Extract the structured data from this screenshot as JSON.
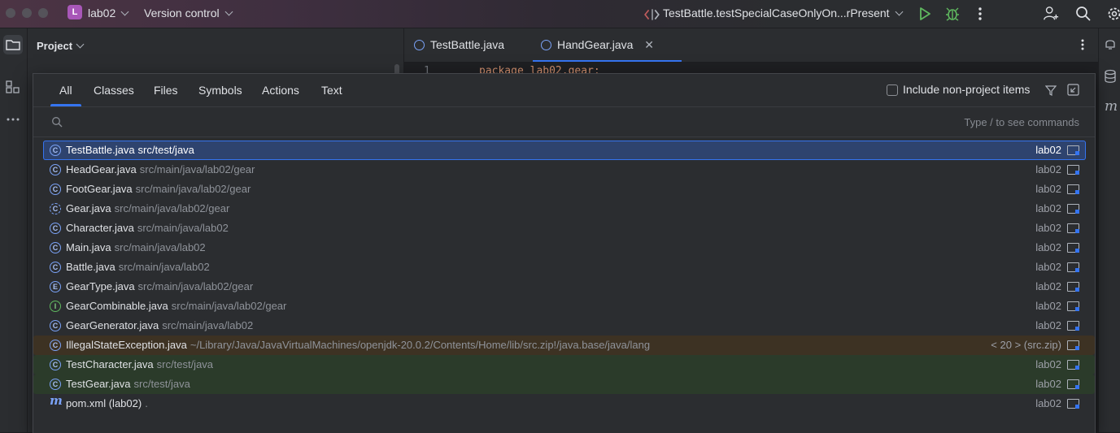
{
  "titlebar": {
    "project_initial": "L",
    "project_name": "lab02",
    "vcs_label": "Version control",
    "run_config": "TestBattle.testSpecialCaseOnlyOn...rPresent"
  },
  "project_panel": {
    "title": "Project"
  },
  "editor": {
    "tabs": [
      {
        "label": "TestBattle.java"
      },
      {
        "label": "HandGear.java"
      }
    ],
    "line_number": "1",
    "code": "package lab02.gear;"
  },
  "search_popup": {
    "tabs": [
      "All",
      "Classes",
      "Files",
      "Symbols",
      "Actions",
      "Text"
    ],
    "include_non_project_label": "Include non-project items",
    "include_non_project_checked": false,
    "search_value": "",
    "hint": "Type / to see commands",
    "results": [
      {
        "name": "TestBattle.java",
        "path": "src/test/java",
        "module": "lab02",
        "kind": "class",
        "style": "selected"
      },
      {
        "name": "HeadGear.java",
        "path": "src/main/java/lab02/gear",
        "module": "lab02",
        "kind": "class",
        "style": "normal"
      },
      {
        "name": "FootGear.java",
        "path": "src/main/java/lab02/gear",
        "module": "lab02",
        "kind": "class",
        "style": "normal"
      },
      {
        "name": "Gear.java",
        "path": "src/main/java/lab02/gear",
        "module": "lab02",
        "kind": "abstract",
        "style": "normal"
      },
      {
        "name": "Character.java",
        "path": "src/main/java/lab02",
        "module": "lab02",
        "kind": "class",
        "style": "normal"
      },
      {
        "name": "Main.java",
        "path": "src/main/java/lab02",
        "module": "lab02",
        "kind": "class",
        "style": "normal"
      },
      {
        "name": "Battle.java",
        "path": "src/main/java/lab02",
        "module": "lab02",
        "kind": "class",
        "style": "normal"
      },
      {
        "name": "GearType.java",
        "path": "src/main/java/lab02/gear",
        "module": "lab02",
        "kind": "enum",
        "style": "normal"
      },
      {
        "name": "GearCombinable.java",
        "path": "src/main/java/lab02/gear",
        "module": "lab02",
        "kind": "interface",
        "style": "normal"
      },
      {
        "name": "GearGenerator.java",
        "path": "src/main/java/lab02",
        "module": "lab02",
        "kind": "class",
        "style": "normal"
      },
      {
        "name": "IllegalStateException.java",
        "path": "~/Library/Java/JavaVirtualMachines/openjdk-20.0.2/Contents/Home/lib/src.zip!/java.base/java/lang",
        "module": "< 20 > (src.zip)",
        "kind": "class",
        "style": "external"
      },
      {
        "name": "TestCharacter.java",
        "path": "src/test/java",
        "module": "lab02",
        "kind": "class",
        "style": "test"
      },
      {
        "name": "TestGear.java",
        "path": "src/test/java",
        "module": "lab02",
        "kind": "class",
        "style": "test"
      },
      {
        "name": "pom.xml (lab02)",
        "path": ".",
        "module": "lab02",
        "kind": "maven",
        "style": "normal"
      }
    ]
  },
  "colors": {
    "accent": "#3574f0",
    "selection_bg": "#2e436e",
    "external_bg": "#3d3223",
    "test_bg": "#2b3b2a"
  }
}
